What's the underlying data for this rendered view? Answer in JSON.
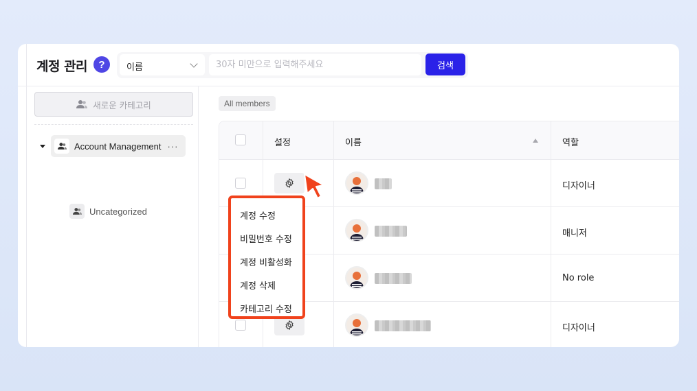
{
  "header": {
    "title": "계정 관리",
    "help_icon": "question-icon",
    "search_field_select": "이름",
    "search_placeholder": "30자 미만으로 입력해주세요",
    "search_button": "검색"
  },
  "sidebar": {
    "new_category_label": "새로운 카테고리",
    "categories": [
      {
        "label": "Account Management",
        "more": "···"
      },
      {
        "label": "Uncategorized"
      }
    ]
  },
  "main": {
    "filter_pill": "All members",
    "columns": [
      "설정",
      "이름",
      "역할"
    ],
    "rows": [
      {
        "role": "디자이너"
      },
      {
        "role": "매니저"
      },
      {
        "role": "No role"
      },
      {
        "role": "디자이너"
      }
    ],
    "context_menu": [
      "계정 수정",
      "비밀번호 수정",
      "계정 비활성화",
      "계정 삭제",
      "카테고리 수정"
    ]
  },
  "colors": {
    "accent": "#2a22e8",
    "help": "#4f46e5",
    "highlight": "#f0421c"
  }
}
